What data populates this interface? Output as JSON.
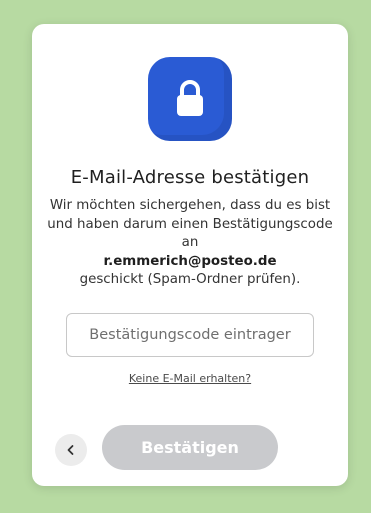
{
  "dialog": {
    "title": "E-Mail-Adresse bestätigen",
    "description_before": "Wir möchten sichergehen, dass du es bist und haben darum einen Bestätigungscode an",
    "email": "r.emmerich@posteo.de",
    "description_after": "geschickt (Spam-Ordner prüfen).",
    "code_input": {
      "placeholder": "Bestätigungscode eintrager",
      "value": ""
    },
    "no_mail_link": "Keine E-Mail erhalten?",
    "confirm_label": "Bestätigen",
    "back_icon": "chevron-left-icon",
    "lock_icon": "lock-icon"
  },
  "colors": {
    "background": "#b7daa2",
    "accent": "#2a5bd4",
    "button_disabled": "#c9cacd"
  }
}
